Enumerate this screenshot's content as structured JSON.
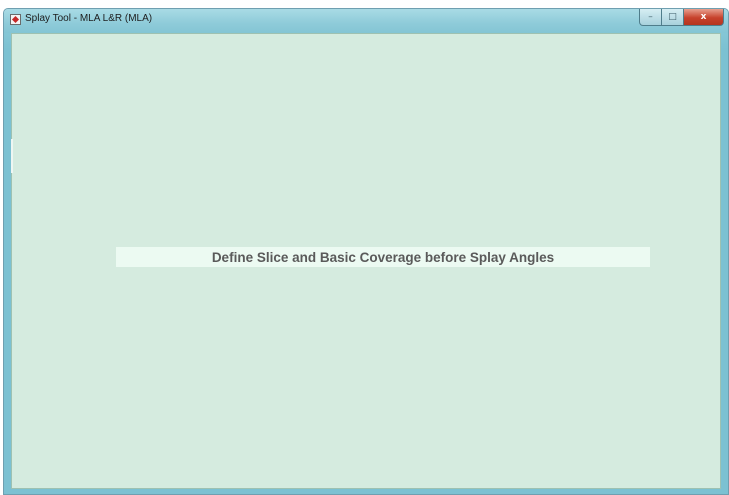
{
  "window": {
    "title": "Splay Tool - MLA L&R (MLA)",
    "controls": {
      "minimize": "–",
      "maximize": "□",
      "close": "x"
    }
  },
  "main": {
    "message": "Define Slice and Basic Coverage before Splay Angles"
  },
  "colors": {
    "client_background": "#d5ebdf",
    "message_background": "#ecfaf2",
    "message_text": "#5a5a5a",
    "titlebar": "#8ecbd9",
    "close_button": "#c7422c"
  },
  "icons": {
    "app": "matlab-figure-icon"
  }
}
